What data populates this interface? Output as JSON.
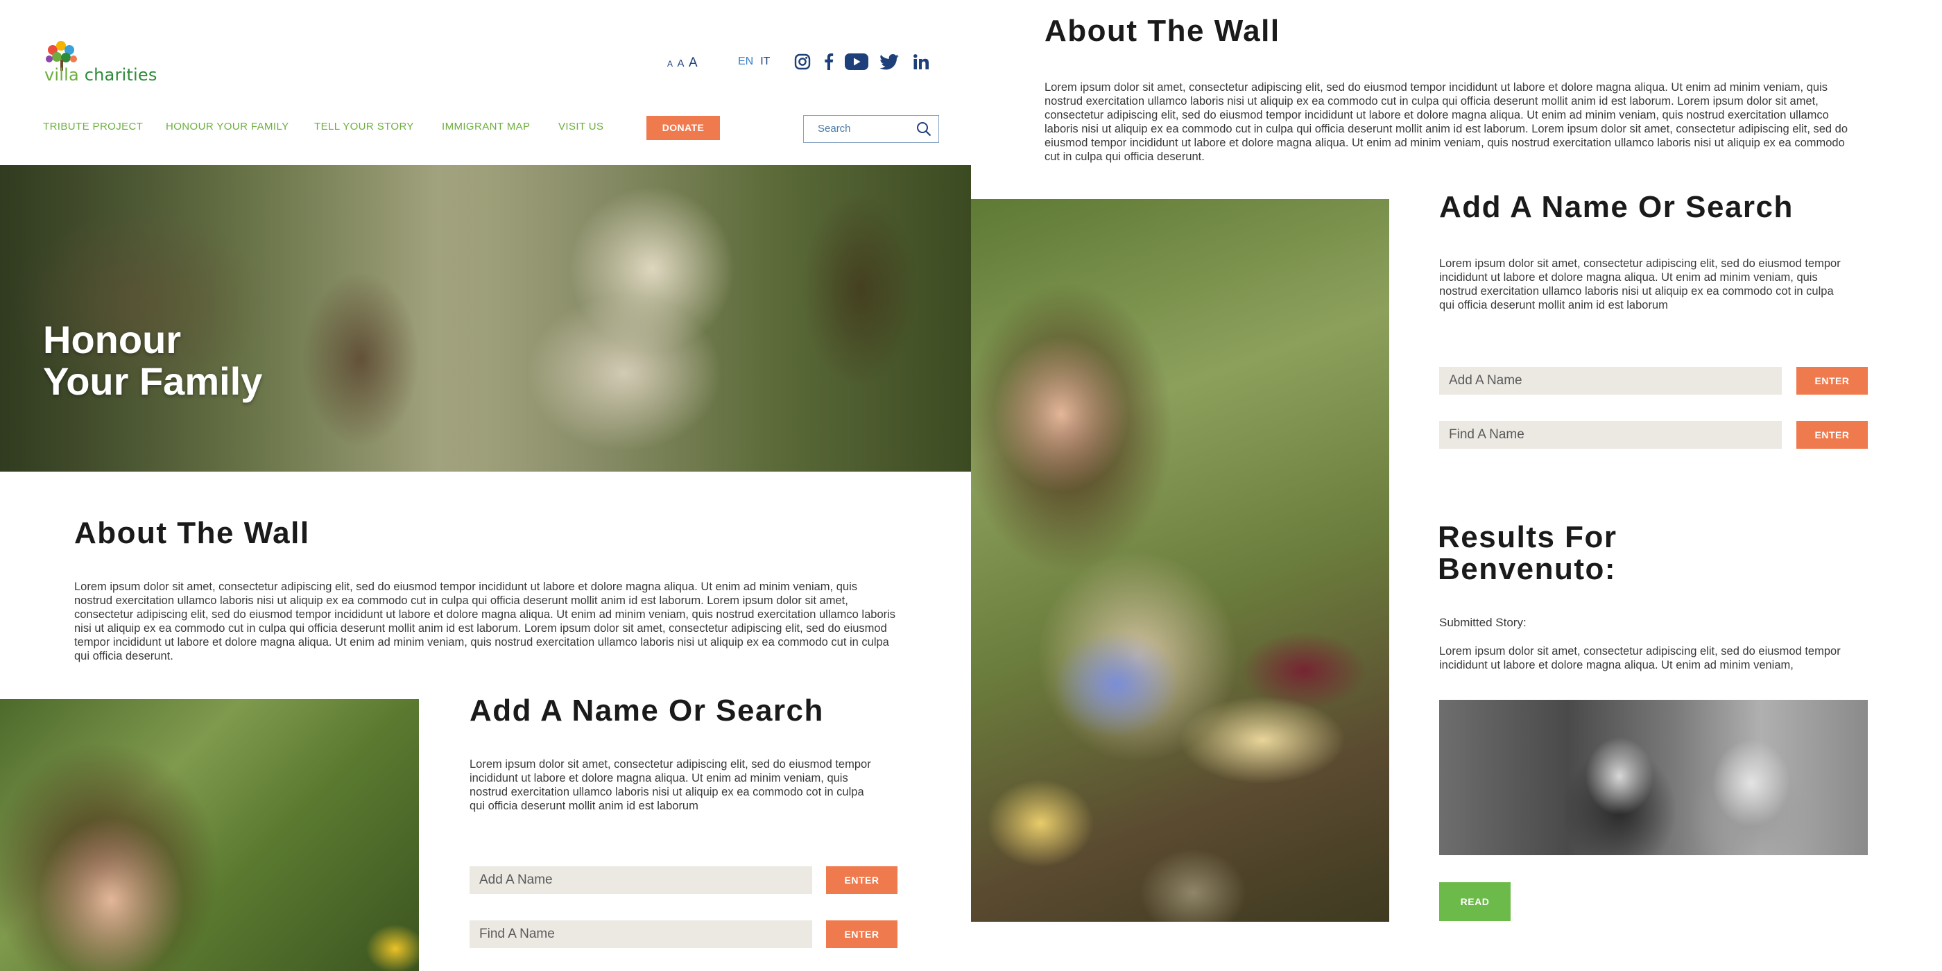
{
  "brand": {
    "logo_text_v": "villa",
    "logo_text_rest": " charities"
  },
  "header": {
    "font_size_labels": [
      "A",
      "A",
      "A"
    ],
    "languages": [
      "EN",
      "IT"
    ],
    "social_icons": [
      "instagram-icon",
      "facebook-icon",
      "youtube-icon",
      "twitter-icon",
      "linkedin-icon"
    ],
    "nav": [
      "TRIBUTE PROJECT",
      "HONOUR YOUR FAMILY",
      "TELL YOUR STORY",
      "IMMIGRANT MAP",
      "VISIT US"
    ],
    "donate_label": "DONATE",
    "search_placeholder": "Search"
  },
  "hero": {
    "title_line1": "Honour",
    "title_line2": "Your Family"
  },
  "about": {
    "title": "About The Wall",
    "body": "Lorem ipsum dolor sit amet, consectetur adipiscing elit, sed do eiusmod tempor incididunt ut labore et dolore magna aliqua. Ut enim ad minim veniam, quis nostrud exercitation ullamco laboris nisi ut aliquip ex ea commodo cut in culpa qui officia deserunt mollit anim id est laborum. Lorem ipsum dolor sit amet, consectetur adipiscing elit, sed do eiusmod tempor incididunt ut labore et dolore magna aliqua. Ut enim ad minim veniam, quis nostrud exercitation ullamco laboris nisi ut aliquip ex ea commodo cut in culpa qui officia deserunt mollit anim id est laborum. Lorem ipsum dolor sit amet, consectetur adipiscing elit, sed do eiusmod tempor incididunt ut labore et dolore magna aliqua. Ut enim ad minim veniam, quis nostrud exercitation ullamco laboris nisi ut aliquip ex ea commodo cut in culpa qui officia deserunt."
  },
  "add_search": {
    "title": "Add A Name Or Search",
    "body": "Lorem ipsum dolor sit amet, consectetur adipiscing elit, sed do eiusmod tempor incididunt ut labore et dolore magna aliqua. Ut enim ad minim veniam, quis nostrud exercitation ullamco laboris nisi ut aliquip ex ea commodo cot in culpa qui officia deserunt mollit anim id est laborum",
    "add_placeholder": "Add A Name",
    "find_placeholder": "Find A Name",
    "enter_label": "ENTER"
  },
  "results": {
    "title_line1": "Results For",
    "title_line2": "Benvenuto:",
    "submitted_label": "Submitted Story:",
    "story_excerpt": "Lorem ipsum dolor sit amet, consectetur adipiscing elit, sed do eiusmod tempor incididunt ut labore et dolore magna aliqua. Ut enim ad minim veniam,",
    "read_label": "READ"
  },
  "colors": {
    "accent_orange": "#ef7a4d",
    "brand_green": "#6cae3e",
    "read_green": "#6cba4a",
    "nav_blue": "#1d3f7a"
  }
}
